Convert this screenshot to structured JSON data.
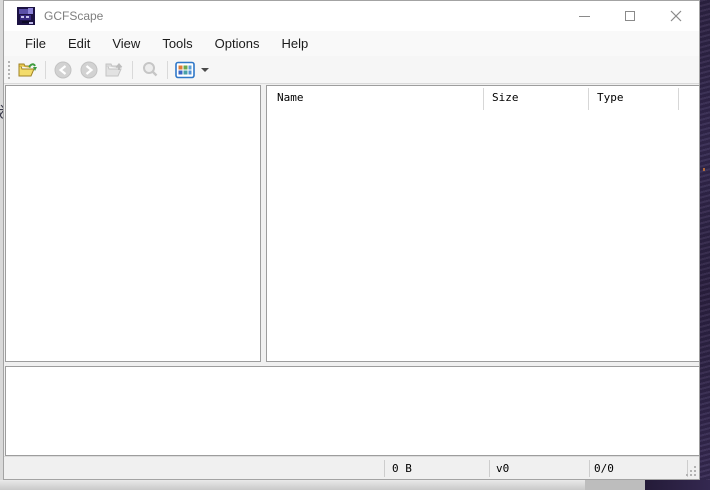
{
  "window": {
    "title": "GCFScape",
    "controls": {
      "minimize_icon": "minimize-icon",
      "maximize_icon": "maximize-icon",
      "close_icon": "close-icon"
    }
  },
  "menu": {
    "items": [
      "File",
      "Edit",
      "View",
      "Tools",
      "Options",
      "Help"
    ]
  },
  "toolbar": {
    "icons": [
      {
        "name": "open-folder-icon",
        "enabled": true
      },
      {
        "name": "back-icon",
        "enabled": false
      },
      {
        "name": "forward-icon",
        "enabled": false
      },
      {
        "name": "up-icon",
        "enabled": false
      },
      {
        "name": "search-icon",
        "enabled": false
      },
      {
        "name": "view-mode-icon",
        "enabled": true
      }
    ]
  },
  "file_list": {
    "columns": [
      "Name",
      "Size",
      "Type"
    ],
    "rows": []
  },
  "tree": {
    "items": []
  },
  "console": {
    "lines": []
  },
  "status_bar": {
    "size_label": "0 B",
    "version_label": "v0",
    "count_label": "0/0"
  },
  "colors": {
    "accent_folder": "#edc84f",
    "accent_arrow_green": "#3f9c3f",
    "view_icon_blue": "#2e77c8",
    "desktop_purple": "#302447",
    "inactive_title_text": "#7f7f7f"
  }
}
